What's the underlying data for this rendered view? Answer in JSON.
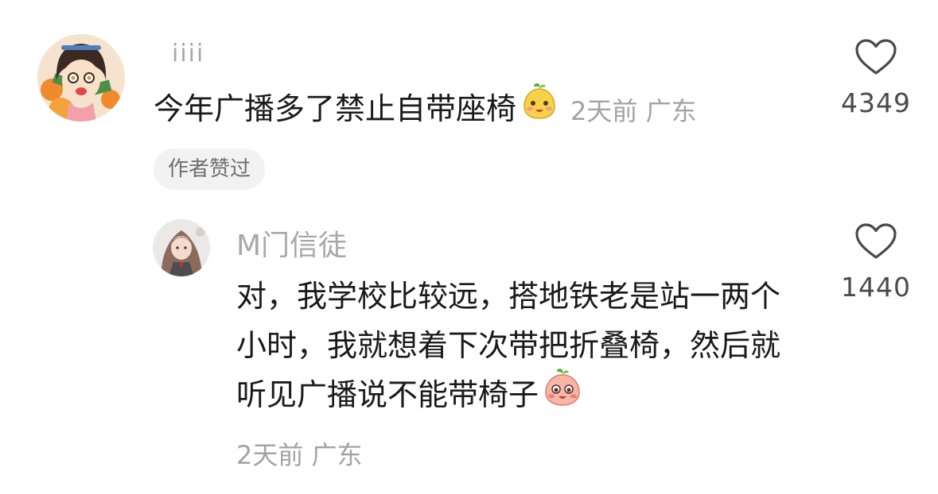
{
  "comments": [
    {
      "username": "iiii",
      "text": "今年广播多了禁止自带座椅",
      "emoji_icon": "pear-face-emoji",
      "time": "2天前",
      "location": "广东",
      "badge": "作者赞过",
      "likes": "4349"
    }
  ],
  "replies": [
    {
      "username": "M门信徒",
      "text": "对，我学校比较远，搭地铁老是站一两个小时，我就想着下次带把折叠椅，然后就听见广播说不能带椅子",
      "emoji_icon": "peach-face-emoji",
      "time": "2天前",
      "location": "广东",
      "likes": "1440"
    }
  ],
  "icons": {
    "like": "heart-outline-icon"
  },
  "colors": {
    "text_primary": "#1a1a1a",
    "text_secondary": "#a3a3a3",
    "badge_bg": "#f2f2f2"
  }
}
